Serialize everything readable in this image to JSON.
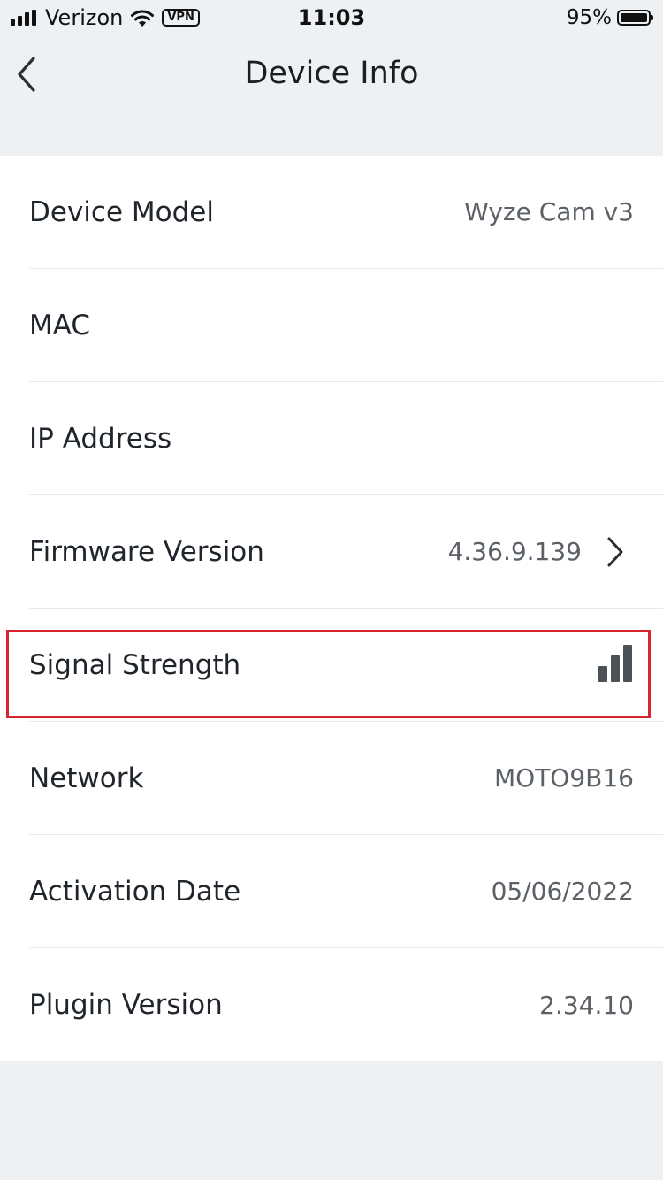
{
  "status_bar": {
    "carrier": "Verizon",
    "vpn_label": "VPN",
    "time": "11:03",
    "battery_percent": "95%",
    "battery_level": 0.95,
    "cellular_icon": "cellular-signal-icon",
    "wifi_icon": "wifi-icon",
    "battery_icon": "battery-icon"
  },
  "header": {
    "title": "Device Info",
    "back_icon": "chevron-left-icon"
  },
  "rows": [
    {
      "label": "Device Model",
      "value": "Wyze Cam v3"
    },
    {
      "label": "MAC",
      "value": ""
    },
    {
      "label": "IP Address",
      "value": ""
    },
    {
      "label": "Firmware Version",
      "value": "4.36.9.139",
      "icon": "chevron-right-icon"
    },
    {
      "label": "Signal Strength",
      "value": "",
      "icon": "signal-strength-icon",
      "signal_level": 3
    },
    {
      "label": "Network",
      "value": "MOTO9B16"
    },
    {
      "label": "Activation Date",
      "value": "05/06/2022"
    },
    {
      "label": "Plugin Version",
      "value": "2.34.10"
    }
  ],
  "colors": {
    "background": "#eef1f4",
    "card": "#ffffff",
    "highlight": "#d7252b",
    "value_text": "#5c6167"
  }
}
